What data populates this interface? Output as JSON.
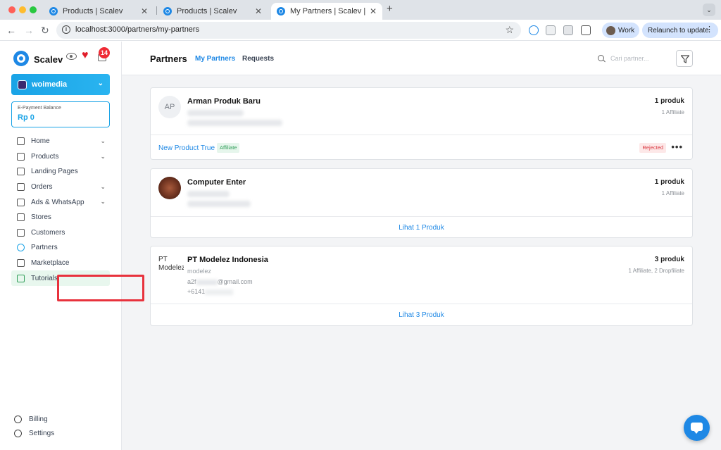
{
  "browser": {
    "tabs": [
      {
        "title": "Products | Scalev",
        "active": false
      },
      {
        "title": "Products | Scalev",
        "active": false
      },
      {
        "title": "My Partners | Scalev | Scalev",
        "active": true
      }
    ],
    "url": "localhost:3000/partners/my-partners",
    "profile_label": "Work",
    "relaunch_label": "Relaunch to update"
  },
  "sidebar": {
    "brand": "Scalev",
    "notification_count": "14",
    "store_name": "woimedia",
    "balance_label": "E-Payment Balance",
    "balance_value": "Rp 0",
    "items": [
      {
        "label": "Home",
        "icon": "home-icon",
        "has_chevron": true
      },
      {
        "label": "Products",
        "icon": "box-icon",
        "has_chevron": true
      },
      {
        "label": "Landing Pages",
        "icon": "file-icon",
        "has_chevron": false
      },
      {
        "label": "Orders",
        "icon": "clipboard-icon",
        "has_chevron": true
      },
      {
        "label": "Ads & WhatsApp",
        "icon": "megaphone-icon",
        "has_chevron": true
      },
      {
        "label": "Stores",
        "icon": "store-icon",
        "has_chevron": false
      },
      {
        "label": "Customers",
        "icon": "users-icon",
        "has_chevron": false
      },
      {
        "label": "Partners",
        "icon": "link-icon",
        "has_chevron": false
      },
      {
        "label": "Marketplace",
        "icon": "cart-icon",
        "has_chevron": false
      },
      {
        "label": "Tutorials",
        "icon": "video-icon",
        "has_chevron": false
      }
    ],
    "bottom": [
      {
        "label": "Billing",
        "icon": "money-bag-icon"
      },
      {
        "label": "Settings",
        "icon": "gear-icon"
      }
    ]
  },
  "header": {
    "title": "Partners",
    "tabs": [
      "My Partners",
      "Requests"
    ],
    "search_placeholder": "Cari partner..."
  },
  "partners": [
    {
      "initials": "AP",
      "name": "Arman Produk Baru",
      "count": "1 produk",
      "types": "1 Affiliate",
      "product_link": "New Product True",
      "product_tag": "Affiliate",
      "status": "Rejected"
    },
    {
      "name": "Computer Enter",
      "count": "1 produk",
      "types": "1 Affiliate",
      "footer_link": "Lihat 1 Produk"
    },
    {
      "avatar_alt": "PT Modelez",
      "name": "PT Modelez Indonesia",
      "username": "modelez",
      "email_start": "a2f",
      "email_end": "@gmail.com",
      "phone_start": "+6141",
      "count": "3 produk",
      "types": "1 Affiliate, 2 Dropfiliate",
      "footer_link": "Lihat 3 Produk"
    }
  ],
  "colors": {
    "accent": "#1e88e5",
    "store_gradient": "#1aa3e6",
    "rejected": "#d9363e",
    "affiliate": "#2e9d57",
    "annotation_box": "#e8323d"
  }
}
